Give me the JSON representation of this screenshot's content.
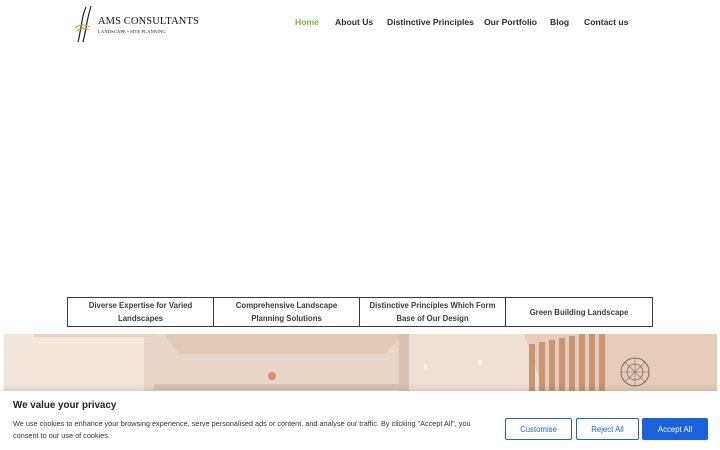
{
  "logo": {
    "title": "AMS CONSULTANTS",
    "subtitle": "LANDSCAPE  •  SITE PLANNING"
  },
  "nav": {
    "items": [
      {
        "label": "Home",
        "active": true
      },
      {
        "label": "About Us",
        "active": false
      },
      {
        "label": "Distinctive Principles",
        "active": false
      },
      {
        "label": "Our Portfolio",
        "active": false
      },
      {
        "label": "Blog",
        "active": false
      },
      {
        "label": "Contact us",
        "active": false
      }
    ]
  },
  "tabs": [
    {
      "label": "Diverse Expertise for Varied Landscapes"
    },
    {
      "label": "Comprehensive Landscape Planning Solutions"
    },
    {
      "label": "Distinctive Principles Which Form Base of Our Design"
    },
    {
      "label": "Green Building Landscape"
    }
  ],
  "cookie": {
    "title": "We value your privacy",
    "text": "We use cookies to enhance your browsing experience, serve personalised ads or content, and analyse our traffic. By clicking \"Accept All\", you consent to our use of cookies.",
    "customise_label": "Customise",
    "reject_label": "Reject All",
    "accept_label": "Accept All"
  },
  "colors": {
    "accent_green": "#7ab648",
    "cookie_blue": "#1863dc"
  }
}
